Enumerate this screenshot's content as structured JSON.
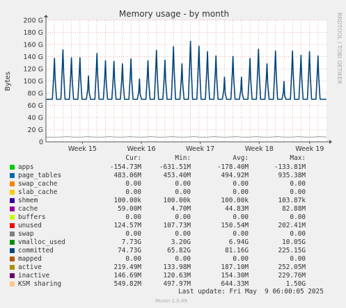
{
  "chart_data": {
    "type": "line",
    "title": "Memory usage - by month",
    "ylabel": "Bytes",
    "side_label": "RRDTOOL / TOBI OETIKER",
    "y_ticks": [
      "0",
      "20 G",
      "40 G",
      "60 G",
      "80 G",
      "100 G",
      "120 G",
      "140 G",
      "160 G",
      "180 G",
      "200 G"
    ],
    "ylim": [
      0,
      200
    ],
    "x_ticks": [
      "Week 15",
      "Week 16",
      "Week 17",
      "Week 18",
      "Week 19"
    ],
    "grid": true,
    "series": [
      {
        "name": "committed",
        "color": "#00457a",
        "baseline": 70,
        "peaks": [
          138,
          152,
          139,
          139,
          109,
          146,
          134,
          133,
          129,
          137,
          104,
          134,
          151,
          135,
          157,
          129,
          166,
          158,
          149,
          142,
          107,
          141,
          107,
          138,
          153,
          129,
          150,
          100,
          150,
          143,
          149,
          142
        ]
      },
      {
        "name": "vmalloc_used",
        "color": "#999999",
        "baseline": 7.7
      }
    ],
    "columns": [
      "Cur:",
      "Min:",
      "Avg:",
      "Max:"
    ],
    "legend": [
      {
        "name": "apps",
        "color": "#00cc00",
        "cur": "-154.73M",
        "min": "-631.51M",
        "avg": "-178.40M",
        "max": "-133.81M"
      },
      {
        "name": "page_tables",
        "color": "#0066b3",
        "cur": "483.06M",
        "min": "453.40M",
        "avg": "494.92M",
        "max": "935.38M"
      },
      {
        "name": "swap_cache",
        "color": "#ff8000",
        "cur": "0.00",
        "min": "0.00",
        "avg": "0.00",
        "max": "0.00"
      },
      {
        "name": "slab_cache",
        "color": "#ffcc00",
        "cur": "0.00",
        "min": "0.00",
        "avg": "0.00",
        "max": "0.00"
      },
      {
        "name": "shmem",
        "color": "#330099",
        "cur": "100.00k",
        "min": "100.00k",
        "avg": "100.00k",
        "max": "103.87k"
      },
      {
        "name": "cache",
        "color": "#990099",
        "cur": "59.00M",
        "min": "4.70M",
        "avg": "44.83M",
        "max": "82.88M"
      },
      {
        "name": "buffers",
        "color": "#ccff00",
        "cur": "0.00",
        "min": "0.00",
        "avg": "0.00",
        "max": "0.00"
      },
      {
        "name": "unused",
        "color": "#ff0000",
        "cur": "124.57M",
        "min": "107.73M",
        "avg": "150.54M",
        "max": "202.41M"
      },
      {
        "name": "swap",
        "color": "#808080",
        "cur": "0.00",
        "min": "0.00",
        "avg": "0.00",
        "max": "0.00"
      },
      {
        "name": "vmalloc_used",
        "color": "#008f00",
        "cur": "7.73G",
        "min": "3.20G",
        "avg": "6.94G",
        "max": "10.05G"
      },
      {
        "name": "committed",
        "color": "#00487d",
        "cur": "74.73G",
        "min": "65.82G",
        "avg": "81.16G",
        "max": "225.15G"
      },
      {
        "name": "mapped",
        "color": "#b35a00",
        "cur": "0.00",
        "min": "0.00",
        "avg": "0.00",
        "max": "0.00"
      },
      {
        "name": "active",
        "color": "#b38f00",
        "cur": "219.49M",
        "min": "133.98M",
        "avg": "187.10M",
        "max": "252.05M"
      },
      {
        "name": "inactive",
        "color": "#6b006b",
        "cur": "146.69M",
        "min": "120.63M",
        "avg": "154.30M",
        "max": "229.76M"
      },
      {
        "name": "KSM sharing",
        "color": "#ffc58a",
        "cur": "549.82M",
        "min": "497.97M",
        "avg": "644.33M",
        "max": "1.50G"
      }
    ],
    "last_update": "Last update: Fri May  9 06:00:05 2025",
    "footer": "Munin 2.0.49"
  }
}
